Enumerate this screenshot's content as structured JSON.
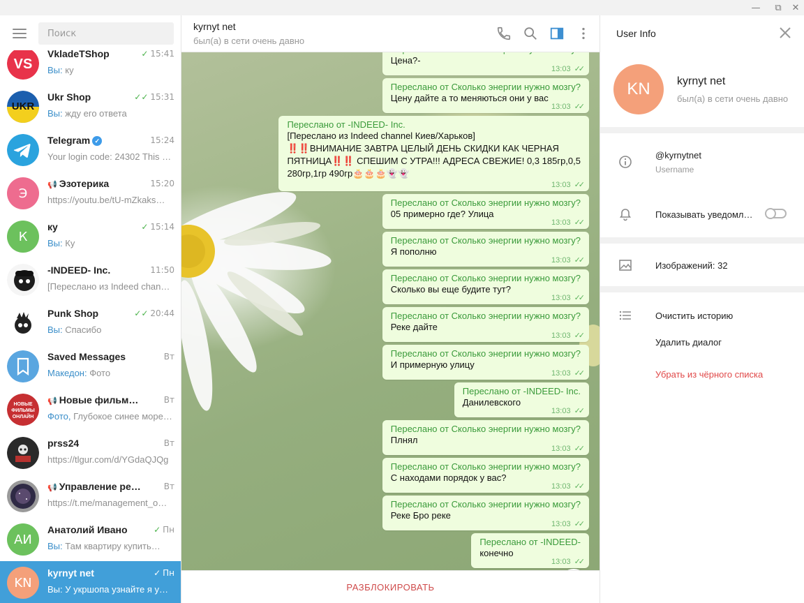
{
  "window": {
    "minimize_glyph": "—",
    "maximize_glyph": "⧉",
    "close_glyph": "✕"
  },
  "search": {
    "placeholder": "Поиск"
  },
  "chats": [
    {
      "name": "VkladeTShop",
      "time": "15:41",
      "sender": "Вы:",
      "preview": " ку",
      "avatar_text": "VS",
      "avatar_color": "#e8334a",
      "checks": "✓",
      "icon": "vs-logo"
    },
    {
      "name": "Ukr Shop",
      "time": "15:31",
      "sender": "Вы:",
      "preview": " жду его ответа",
      "avatar_text": "UKR",
      "avatar_color": "#1c5fae",
      "checks": "✓✓",
      "icon": "ukr-logo"
    },
    {
      "name": "Telegram",
      "time": "15:24",
      "sender": "",
      "preview": "Your login code: 24302  This c…",
      "avatar_text": "",
      "avatar_color": "#2aa3de",
      "checks": "",
      "icon": "telegram-logo",
      "verified": true
    },
    {
      "name": "Эзотерика",
      "time": "15:20",
      "sender": "",
      "preview": "https://youtu.be/tU-mZkaks…",
      "avatar_text": "Э",
      "avatar_color": "#ee6c8f",
      "checks": "",
      "channel": true
    },
    {
      "name": "ку",
      "time": "15:14",
      "sender": "Вы:",
      "preview": " Ку",
      "avatar_text": "К",
      "avatar_color": "#6cc15d",
      "checks": "✓"
    },
    {
      "name": "-INDEED- Inc.",
      "time": "11:50",
      "sender": "",
      "preview": "[Переслано из Indeed chann…",
      "avatar_text": "",
      "avatar_color": "#222222",
      "checks": "",
      "icon": "indeed-logo"
    },
    {
      "name": "Punk Shop",
      "time": "20:44",
      "sender": "Вы:",
      "preview": " Спасибо",
      "avatar_text": "",
      "avatar_color": "#ffffff",
      "checks": "✓✓",
      "icon": "punk-logo"
    },
    {
      "name": "Saved Messages",
      "time": "Вт",
      "sender": "Македон:",
      "preview": " Фото",
      "avatar_text": "",
      "avatar_color": "#5aa6e0",
      "checks": "",
      "icon": "bookmark-icon"
    },
    {
      "name": "Новые фильмы он…",
      "time": "Вт",
      "sender": "Фото,",
      "preview": " Глубокое синее море…",
      "avatar_text": "",
      "avatar_color": "#c62f32",
      "checks": "",
      "channel": true,
      "icon": "films-logo"
    },
    {
      "name": "prss24",
      "time": "Вт",
      "sender": "",
      "preview": "https://tlgur.com/d/YGdaQJQg",
      "avatar_text": "",
      "avatar_color": "#2a2a2a",
      "checks": "",
      "icon": "prss-logo"
    },
    {
      "name": "Управление реальн…",
      "time": "Вт",
      "sender": "",
      "preview": "https://t.me/management_o…",
      "avatar_text": "",
      "avatar_color": "#3b3550",
      "checks": "",
      "channel": true,
      "icon": "space-logo"
    },
    {
      "name": "Анатолий Ивано",
      "time": "Пн",
      "sender": "Вы:",
      "preview": " Там квартиру купить…",
      "avatar_text": "АИ",
      "avatar_color": "#6cc15d",
      "checks": "✓"
    },
    {
      "name": "kyrnyt net",
      "time": "Пн",
      "sender": "Вы:",
      "preview": " У укршопа узнайте я у…",
      "avatar_text": "KN",
      "avatar_color": "#f4a07a",
      "checks": "✓",
      "active": true
    }
  ],
  "conversation": {
    "name": "kyrnyt net",
    "status": "был(а) в сети очень давно",
    "messages": [
      {
        "fwd": "Переслано от Сколько энергии нужно мозгу?",
        "lines": [
          "Цена?-"
        ],
        "time": "13:03"
      },
      {
        "fwd": "Переслано от Сколько энергии нужно мозгу?",
        "lines": [
          "Цену дайте а то меняються они у вас"
        ],
        "time": "13:03"
      },
      {
        "fwd": "Переслано от -INDEED- Inc.",
        "lines": [
          "[Переслано из Indeed channel Киев/Харьков]",
          "‼️‼️ВНИМАНИЕ ЗАВТРА ЦЕЛЫЙ ДЕНЬ СКИДКИ КАК ЧЕРНАЯ",
          "ПЯТНИЦА‼️‼️ СПЕШИМ С УТРА!!! АДРЕСА СВЕЖИЕ! 0,3 185гр,0,5",
          "280гр,1гр 490гр🎂🎂🎂👻👻"
        ],
        "time": "13:03"
      },
      {
        "fwd": "Переслано от Сколько энергии нужно мозгу?",
        "lines": [
          "05 примерно где? Улица"
        ],
        "time": "13:03"
      },
      {
        "fwd": "Переслано от Сколько энергии нужно мозгу?",
        "lines": [
          "Я пополню"
        ],
        "time": "13:03"
      },
      {
        "fwd": "Переслано от Сколько энергии нужно мозгу?",
        "lines": [
          "Сколько вы еще будите тут?"
        ],
        "time": "13:03"
      },
      {
        "fwd": "Переслано от Сколько энергии нужно мозгу?",
        "lines": [
          "Реке дайте"
        ],
        "time": "13:03"
      },
      {
        "fwd": "Переслано от Сколько энергии нужно мозгу?",
        "lines": [
          "И примерную улицу"
        ],
        "time": "13:03"
      },
      {
        "fwd": "Переслано от -INDEED- Inc.",
        "lines": [
          "Данилевского"
        ],
        "time": "13:03"
      },
      {
        "fwd": "Переслано от Сколько энергии нужно мозгу?",
        "lines": [
          "Плнял"
        ],
        "time": "13:03"
      },
      {
        "fwd": "Переслано от Сколько энергии нужно мозгу?",
        "lines": [
          "С находами порядок у вас?"
        ],
        "time": "13:03"
      },
      {
        "fwd": "Переслано от Сколько энергии нужно мозгу?",
        "lines": [
          "Реке Бро реке"
        ],
        "time": "13:03"
      },
      {
        "fwd": "Переслано от -INDEED-",
        "lines": [
          "конечно"
        ],
        "time": "13:03"
      }
    ],
    "unblock_label": "РАЗБЛОКИРОВАТЬ"
  },
  "user_info": {
    "title": "User Info",
    "avatar_text": "KN",
    "name": "kyrnyt net",
    "status": "был(а) в сети очень давно",
    "username": "@kyrnytnet",
    "username_label": "Username",
    "notifications_label": "Показывать уведомл…",
    "images_label": "Изображений: 32",
    "clear_history": "Очистить историю",
    "delete_dialog": "Удалить диалог",
    "remove_blacklist": "Убрать из чёрного списка"
  }
}
